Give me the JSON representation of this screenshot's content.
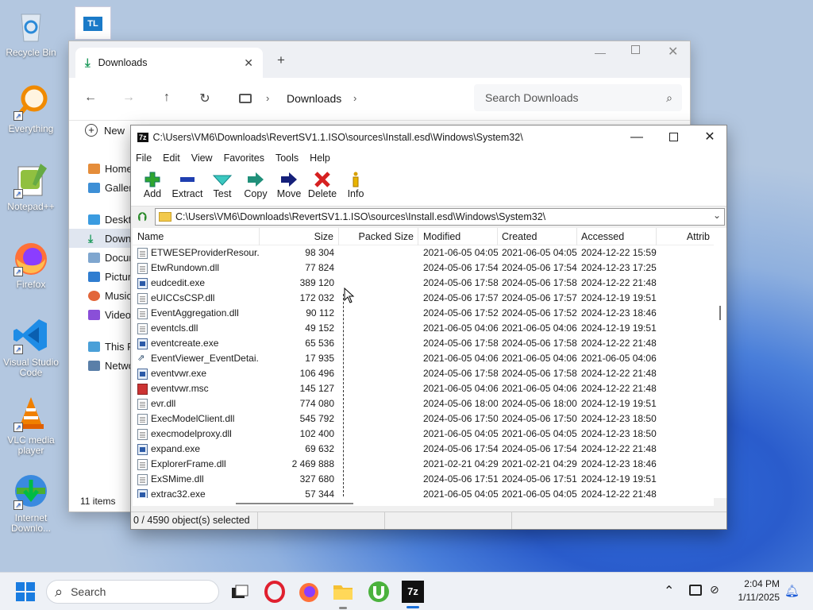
{
  "desktop": {
    "icons": [
      {
        "label": "Recycle Bin",
        "icon": "recycle-bin-icon"
      },
      {
        "label": "Everything",
        "icon": "everything-search-icon"
      },
      {
        "label": "Notepad++",
        "icon": "notepad-plus-icon"
      },
      {
        "label": "Firefox",
        "icon": "firefox-icon"
      },
      {
        "label": "Visual Studio Code",
        "icon": "vscode-icon"
      },
      {
        "label": "VLC media player",
        "icon": "vlc-icon"
      },
      {
        "label": "Internet Downlo...",
        "icon": "idm-icon"
      }
    ],
    "tl_label": "TL"
  },
  "explorer": {
    "tab_label": "Downloads",
    "new_label": "New",
    "breadcrumb": "Downloads",
    "search_placeholder": "Search Downloads",
    "sidebar": [
      "Home",
      "Gallery",
      "Desktop",
      "Downloads",
      "Documents",
      "Pictures",
      "Music",
      "Videos",
      "This PC",
      "Network"
    ],
    "items_count": "11 items"
  },
  "sevenzip": {
    "title": "C:\\Users\\VM6\\Downloads\\RevertSV1.1.ISO\\sources\\Install.esd\\Windows\\System32\\",
    "app_icon_text": "7z",
    "menu": [
      "File",
      "Edit",
      "View",
      "Favorites",
      "Tools",
      "Help"
    ],
    "toolbar": [
      "Add",
      "Extract",
      "Test",
      "Copy",
      "Move",
      "Delete",
      "Info"
    ],
    "address": "C:\\Users\\VM6\\Downloads\\RevertSV1.1.ISO\\sources\\Install.esd\\Windows\\System32\\",
    "columns": [
      "Name",
      "Size",
      "Packed Size",
      "Modified",
      "Created",
      "Accessed",
      "Attrib"
    ],
    "rows": [
      {
        "name": "ETWESEProviderResour...",
        "size": "98 304",
        "modified": "2021-06-05 04:05",
        "created": "2021-06-05 04:05",
        "accessed": "2024-12-22 15:59",
        "type": "dll"
      },
      {
        "name": "EtwRundown.dll",
        "size": "77 824",
        "modified": "2024-05-06 17:54",
        "created": "2024-05-06 17:54",
        "accessed": "2024-12-23 17:25",
        "type": "dll"
      },
      {
        "name": "eudcedit.exe",
        "size": "389 120",
        "modified": "2024-05-06 17:58",
        "created": "2024-05-06 17:58",
        "accessed": "2024-12-22 21:48",
        "type": "exe"
      },
      {
        "name": "eUICCsCSP.dll",
        "size": "172 032",
        "modified": "2024-05-06 17:57",
        "created": "2024-05-06 17:57",
        "accessed": "2024-12-19 19:51",
        "type": "dll"
      },
      {
        "name": "EventAggregation.dll",
        "size": "90 112",
        "modified": "2024-05-06 17:52",
        "created": "2024-05-06 17:52",
        "accessed": "2024-12-23 18:46",
        "type": "dll"
      },
      {
        "name": "eventcls.dll",
        "size": "49 152",
        "modified": "2021-06-05 04:06",
        "created": "2021-06-05 04:06",
        "accessed": "2024-12-19 19:51",
        "type": "dll"
      },
      {
        "name": "eventcreate.exe",
        "size": "65 536",
        "modified": "2024-05-06 17:58",
        "created": "2024-05-06 17:58",
        "accessed": "2024-12-22 21:48",
        "type": "exe"
      },
      {
        "name": "EventViewer_EventDetai...",
        "size": "17 935",
        "modified": "2021-06-05 04:06",
        "created": "2021-06-05 04:06",
        "accessed": "2021-06-05 04:06",
        "type": "lnk"
      },
      {
        "name": "eventvwr.exe",
        "size": "106 496",
        "modified": "2024-05-06 17:58",
        "created": "2024-05-06 17:58",
        "accessed": "2024-12-22 21:48",
        "type": "exe"
      },
      {
        "name": "eventvwr.msc",
        "size": "145 127",
        "modified": "2021-06-05 04:06",
        "created": "2021-06-05 04:06",
        "accessed": "2024-12-22 21:48",
        "type": "msc"
      },
      {
        "name": "evr.dll",
        "size": "774 080",
        "modified": "2024-05-06 18:00",
        "created": "2024-05-06 18:00",
        "accessed": "2024-12-19 19:51",
        "type": "dll"
      },
      {
        "name": "ExecModelClient.dll",
        "size": "545 792",
        "modified": "2024-05-06 17:50",
        "created": "2024-05-06 17:50",
        "accessed": "2024-12-23 18:50",
        "type": "dll"
      },
      {
        "name": "execmodelproxy.dll",
        "size": "102 400",
        "modified": "2021-06-05 04:05",
        "created": "2021-06-05 04:05",
        "accessed": "2024-12-23 18:50",
        "type": "dll"
      },
      {
        "name": "expand.exe",
        "size": "69 632",
        "modified": "2024-05-06 17:54",
        "created": "2024-05-06 17:54",
        "accessed": "2024-12-22 21:48",
        "type": "exe"
      },
      {
        "name": "ExplorerFrame.dll",
        "size": "2 469 888",
        "modified": "2021-02-21 04:29",
        "created": "2021-02-21 04:29",
        "accessed": "2024-12-23 18:46",
        "type": "dll"
      },
      {
        "name": "ExSMime.dll",
        "size": "327 680",
        "modified": "2024-05-06 17:51",
        "created": "2024-05-06 17:51",
        "accessed": "2024-12-19 19:51",
        "type": "dll"
      },
      {
        "name": "extrac32.exe",
        "size": "57 344",
        "modified": "2021-06-05 04:05",
        "created": "2021-06-05 04:05",
        "accessed": "2024-12-22 21:48",
        "type": "exe"
      }
    ],
    "status": "0 / 4590 object(s) selected"
  },
  "taskbar": {
    "search_placeholder": "Search",
    "time": "2:04 PM",
    "date": "1/11/2025"
  }
}
